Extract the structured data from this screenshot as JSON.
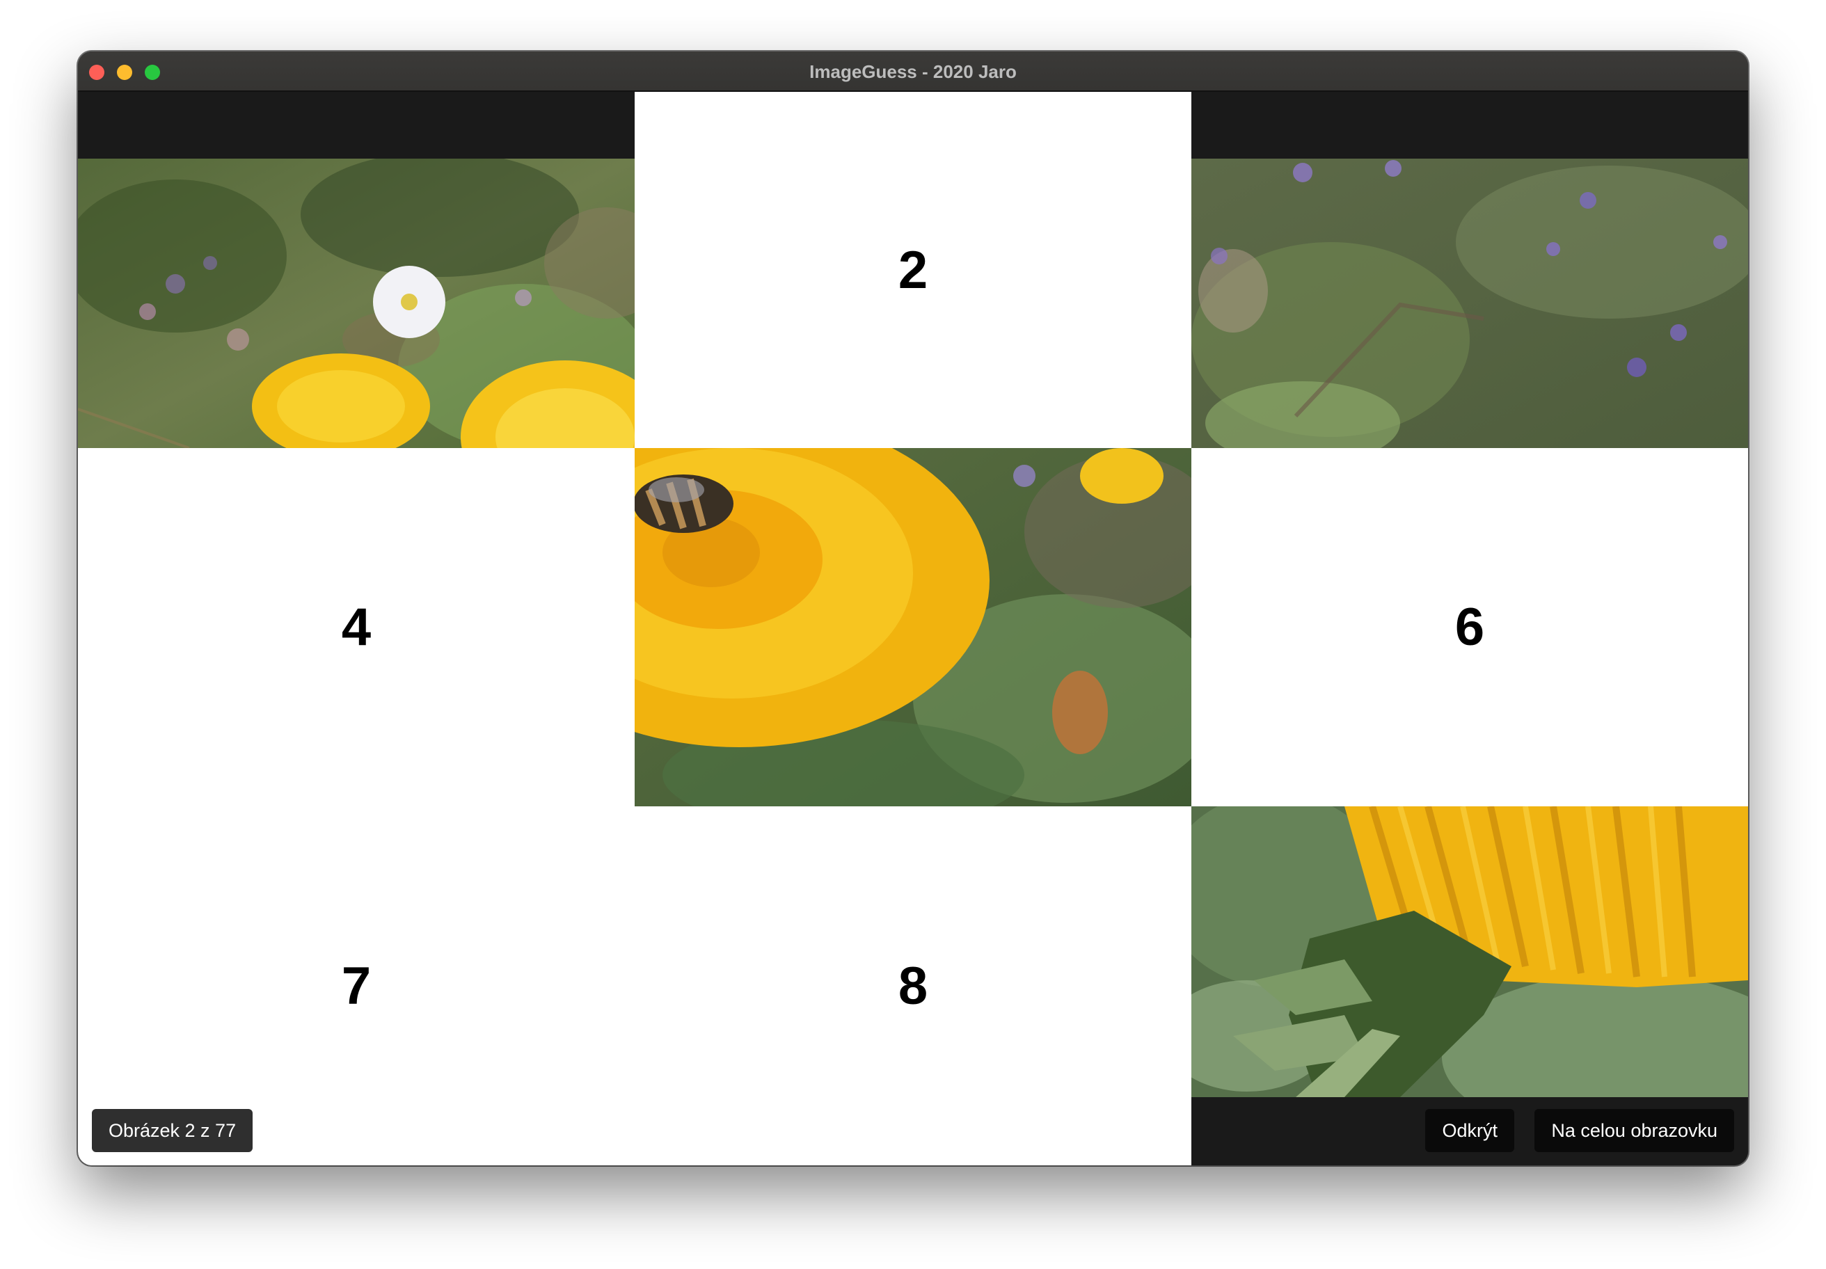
{
  "window": {
    "title": "ImageGuess - 2020 Jaro"
  },
  "grid": {
    "covered_tiles": [
      "2",
      "4",
      "6",
      "7",
      "8"
    ],
    "revealed_tiles": [
      {
        "id": "1",
        "subject": "daisy-and-dandelions"
      },
      {
        "id": "3",
        "subject": "green-foliage-purple-flowers"
      },
      {
        "id": "5",
        "subject": "bee-on-dandelion"
      },
      {
        "id": "9",
        "subject": "dandelion-underside"
      }
    ]
  },
  "footer": {
    "counter": "Obrázek 2 z 77",
    "reveal_label": "Odkrýt",
    "fullscreen_label": "Na celou obrazovku"
  },
  "colors": {
    "background": "#1a1a1a",
    "tile_cover": "#ffffff",
    "dandelion": "#f7c21b"
  }
}
